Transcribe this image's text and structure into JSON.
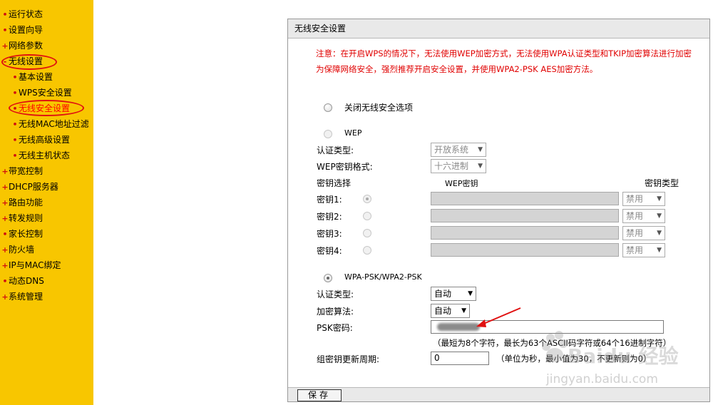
{
  "sidebar": {
    "items": [
      {
        "label": "运行状态"
      },
      {
        "label": "设置向导"
      },
      {
        "label": "网络参数"
      },
      {
        "label": "无线设置"
      },
      {
        "label": "基本设置"
      },
      {
        "label": "WPS安全设置"
      },
      {
        "label": "无线安全设置"
      },
      {
        "label": "无线MAC地址过滤"
      },
      {
        "label": "无线高级设置"
      },
      {
        "label": "无线主机状态"
      },
      {
        "label": "带宽控制"
      },
      {
        "label": "DHCP服务器"
      },
      {
        "label": "路由功能"
      },
      {
        "label": "转发规则"
      },
      {
        "label": "家长控制"
      },
      {
        "label": "防火墙"
      },
      {
        "label": "IP与MAC绑定"
      },
      {
        "label": "动态DNS"
      },
      {
        "label": "系统管理"
      }
    ]
  },
  "panel": {
    "title": "无线安全设置",
    "notice_line1": "注意：在开启WPS的情况下，无法使用WEP加密方式，无法使用WPA认证类型和TKIP加密算法进行加密",
    "notice_line2": "为保障网络安全，强烈推荐开启安全设置，并使用WPA2-PSK AES加密方法。",
    "disable_security_label": "关闭无线安全选项",
    "wep": {
      "label": "WEP",
      "auth_label": "认证类型:",
      "auth_value": "开放系统",
      "format_label": "WEP密钥格式:",
      "format_value": "十六进制",
      "key_select_header": "密钥选择",
      "key_header": "WEP密钥",
      "key_type_header": "密钥类型",
      "keys": [
        {
          "label": "密钥1:",
          "type": "禁用"
        },
        {
          "label": "密钥2:",
          "type": "禁用"
        },
        {
          "label": "密钥3:",
          "type": "禁用"
        },
        {
          "label": "密钥4:",
          "type": "禁用"
        }
      ]
    },
    "wpa": {
      "label": "WPA-PSK/WPA2-PSK",
      "auth_label": "认证类型:",
      "auth_value": "自动",
      "algo_label": "加密算法:",
      "algo_value": "自动",
      "psk_label": "PSK密码:",
      "psk_hint": "（最短为8个字符，最长为63个ASCII码字符或64个16进制字符）",
      "group_label": "组密钥更新周期:",
      "group_value": "0",
      "group_hint": "（单位为秒，最小值为30，不更新则为0）"
    },
    "save_label": "保存"
  },
  "watermark": {
    "text1": "Baidu 经验",
    "text2": "jingyan.baidu.com"
  },
  "colors": {
    "sidebar_bg": "#f8c600",
    "bullet": "#d01010",
    "notice": "#e00000",
    "highlight_ring": "#e01010"
  }
}
